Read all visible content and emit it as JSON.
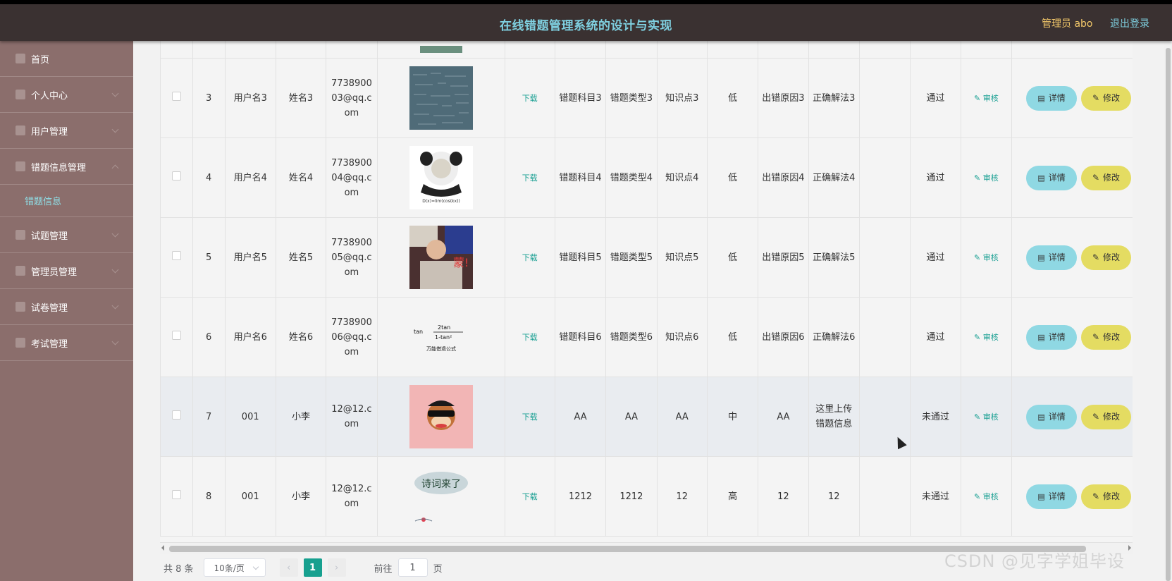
{
  "header": {
    "title": "在线错题管理系统的设计与实现",
    "admin": "管理员 abo",
    "logout": "退出登录"
  },
  "sidebar": {
    "items": [
      {
        "label": "首页",
        "icon": "home-icon"
      },
      {
        "label": "个人中心",
        "icon": "user-icon"
      },
      {
        "label": "用户管理",
        "icon": "users-icon"
      },
      {
        "label": "错题信息管理",
        "icon": "book-icon"
      },
      {
        "label": "试题管理",
        "icon": "list-icon"
      },
      {
        "label": "管理员管理",
        "icon": "chart-icon"
      },
      {
        "label": "试卷管理",
        "icon": "paper-icon"
      },
      {
        "label": "考试管理",
        "icon": "exam-icon"
      }
    ],
    "sub_item": "错题信息"
  },
  "table": {
    "download_label": "下载",
    "audit_label": "审核",
    "detail_label": "详情",
    "edit_label": "修改",
    "rows": [
      {
        "id": "3",
        "username": "用户名3",
        "name": "姓名3",
        "email": "773890003@qq.com",
        "subject": "错题科目3",
        "type": "错题类型3",
        "point": "知识点3",
        "difficulty": "低",
        "reason": "出错原因3",
        "solution": "正确解法3",
        "status": "通过"
      },
      {
        "id": "4",
        "username": "用户名4",
        "name": "姓名4",
        "email": "773890004@qq.com",
        "subject": "错题科目4",
        "type": "错题类型4",
        "point": "知识点4",
        "difficulty": "低",
        "reason": "出错原因4",
        "solution": "正确解法4",
        "status": "通过"
      },
      {
        "id": "5",
        "username": "用户名5",
        "name": "姓名5",
        "email": "773890005@qq.com",
        "subject": "错题科目5",
        "type": "错题类型5",
        "point": "知识点5",
        "difficulty": "低",
        "reason": "出错原因5",
        "solution": "正确解法5",
        "status": "通过"
      },
      {
        "id": "6",
        "username": "用户名6",
        "name": "姓名6",
        "email": "773890006@qq.com",
        "subject": "错题科目6",
        "type": "错题类型6",
        "point": "知识点6",
        "difficulty": "低",
        "reason": "出错原因6",
        "solution": "正确解法6",
        "status": "通过"
      },
      {
        "id": "7",
        "username": "001",
        "name": "小李",
        "email": "12@12.com",
        "subject": "AA",
        "type": "AA",
        "point": "AA",
        "difficulty": "中",
        "reason": "AA",
        "solution": "这里上传错题信息",
        "status": "未通过"
      },
      {
        "id": "8",
        "username": "001",
        "name": "小李",
        "email": "12@12.com",
        "subject": "1212",
        "type": "1212",
        "point": "12",
        "difficulty": "高",
        "reason": "12",
        "solution": "12",
        "status": "未通过"
      }
    ]
  },
  "pager": {
    "total": "共 8 条",
    "page_size": "10条/页",
    "current_page": "1",
    "goto_label": "前往",
    "goto_value": "1",
    "unit": "页"
  },
  "watermark": "CSDN @见字学姐毕设"
}
